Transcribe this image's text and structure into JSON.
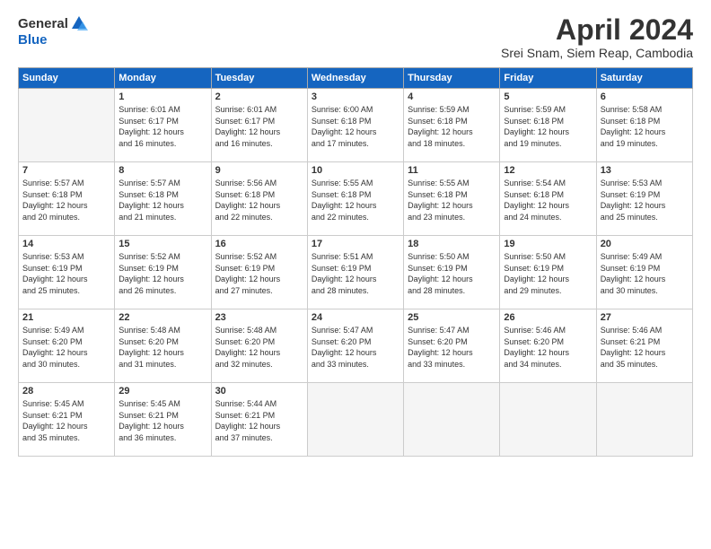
{
  "header": {
    "logo_general": "General",
    "logo_blue": "Blue",
    "month_title": "April 2024",
    "subtitle": "Srei Snam, Siem Reap, Cambodia"
  },
  "weekdays": [
    "Sunday",
    "Monday",
    "Tuesday",
    "Wednesday",
    "Thursday",
    "Friday",
    "Saturday"
  ],
  "weeks": [
    [
      {
        "day": "",
        "info": ""
      },
      {
        "day": "1",
        "info": "Sunrise: 6:01 AM\nSunset: 6:17 PM\nDaylight: 12 hours\nand 16 minutes."
      },
      {
        "day": "2",
        "info": "Sunrise: 6:01 AM\nSunset: 6:17 PM\nDaylight: 12 hours\nand 16 minutes."
      },
      {
        "day": "3",
        "info": "Sunrise: 6:00 AM\nSunset: 6:18 PM\nDaylight: 12 hours\nand 17 minutes."
      },
      {
        "day": "4",
        "info": "Sunrise: 5:59 AM\nSunset: 6:18 PM\nDaylight: 12 hours\nand 18 minutes."
      },
      {
        "day": "5",
        "info": "Sunrise: 5:59 AM\nSunset: 6:18 PM\nDaylight: 12 hours\nand 19 minutes."
      },
      {
        "day": "6",
        "info": "Sunrise: 5:58 AM\nSunset: 6:18 PM\nDaylight: 12 hours\nand 19 minutes."
      }
    ],
    [
      {
        "day": "7",
        "info": "Sunrise: 5:57 AM\nSunset: 6:18 PM\nDaylight: 12 hours\nand 20 minutes."
      },
      {
        "day": "8",
        "info": "Sunrise: 5:57 AM\nSunset: 6:18 PM\nDaylight: 12 hours\nand 21 minutes."
      },
      {
        "day": "9",
        "info": "Sunrise: 5:56 AM\nSunset: 6:18 PM\nDaylight: 12 hours\nand 22 minutes."
      },
      {
        "day": "10",
        "info": "Sunrise: 5:55 AM\nSunset: 6:18 PM\nDaylight: 12 hours\nand 22 minutes."
      },
      {
        "day": "11",
        "info": "Sunrise: 5:55 AM\nSunset: 6:18 PM\nDaylight: 12 hours\nand 23 minutes."
      },
      {
        "day": "12",
        "info": "Sunrise: 5:54 AM\nSunset: 6:18 PM\nDaylight: 12 hours\nand 24 minutes."
      },
      {
        "day": "13",
        "info": "Sunrise: 5:53 AM\nSunset: 6:19 PM\nDaylight: 12 hours\nand 25 minutes."
      }
    ],
    [
      {
        "day": "14",
        "info": "Sunrise: 5:53 AM\nSunset: 6:19 PM\nDaylight: 12 hours\nand 25 minutes."
      },
      {
        "day": "15",
        "info": "Sunrise: 5:52 AM\nSunset: 6:19 PM\nDaylight: 12 hours\nand 26 minutes."
      },
      {
        "day": "16",
        "info": "Sunrise: 5:52 AM\nSunset: 6:19 PM\nDaylight: 12 hours\nand 27 minutes."
      },
      {
        "day": "17",
        "info": "Sunrise: 5:51 AM\nSunset: 6:19 PM\nDaylight: 12 hours\nand 28 minutes."
      },
      {
        "day": "18",
        "info": "Sunrise: 5:50 AM\nSunset: 6:19 PM\nDaylight: 12 hours\nand 28 minutes."
      },
      {
        "day": "19",
        "info": "Sunrise: 5:50 AM\nSunset: 6:19 PM\nDaylight: 12 hours\nand 29 minutes."
      },
      {
        "day": "20",
        "info": "Sunrise: 5:49 AM\nSunset: 6:19 PM\nDaylight: 12 hours\nand 30 minutes."
      }
    ],
    [
      {
        "day": "21",
        "info": "Sunrise: 5:49 AM\nSunset: 6:20 PM\nDaylight: 12 hours\nand 30 minutes."
      },
      {
        "day": "22",
        "info": "Sunrise: 5:48 AM\nSunset: 6:20 PM\nDaylight: 12 hours\nand 31 minutes."
      },
      {
        "day": "23",
        "info": "Sunrise: 5:48 AM\nSunset: 6:20 PM\nDaylight: 12 hours\nand 32 minutes."
      },
      {
        "day": "24",
        "info": "Sunrise: 5:47 AM\nSunset: 6:20 PM\nDaylight: 12 hours\nand 33 minutes."
      },
      {
        "day": "25",
        "info": "Sunrise: 5:47 AM\nSunset: 6:20 PM\nDaylight: 12 hours\nand 33 minutes."
      },
      {
        "day": "26",
        "info": "Sunrise: 5:46 AM\nSunset: 6:20 PM\nDaylight: 12 hours\nand 34 minutes."
      },
      {
        "day": "27",
        "info": "Sunrise: 5:46 AM\nSunset: 6:21 PM\nDaylight: 12 hours\nand 35 minutes."
      }
    ],
    [
      {
        "day": "28",
        "info": "Sunrise: 5:45 AM\nSunset: 6:21 PM\nDaylight: 12 hours\nand 35 minutes."
      },
      {
        "day": "29",
        "info": "Sunrise: 5:45 AM\nSunset: 6:21 PM\nDaylight: 12 hours\nand 36 minutes."
      },
      {
        "day": "30",
        "info": "Sunrise: 5:44 AM\nSunset: 6:21 PM\nDaylight: 12 hours\nand 37 minutes."
      },
      {
        "day": "",
        "info": ""
      },
      {
        "day": "",
        "info": ""
      },
      {
        "day": "",
        "info": ""
      },
      {
        "day": "",
        "info": ""
      }
    ]
  ]
}
